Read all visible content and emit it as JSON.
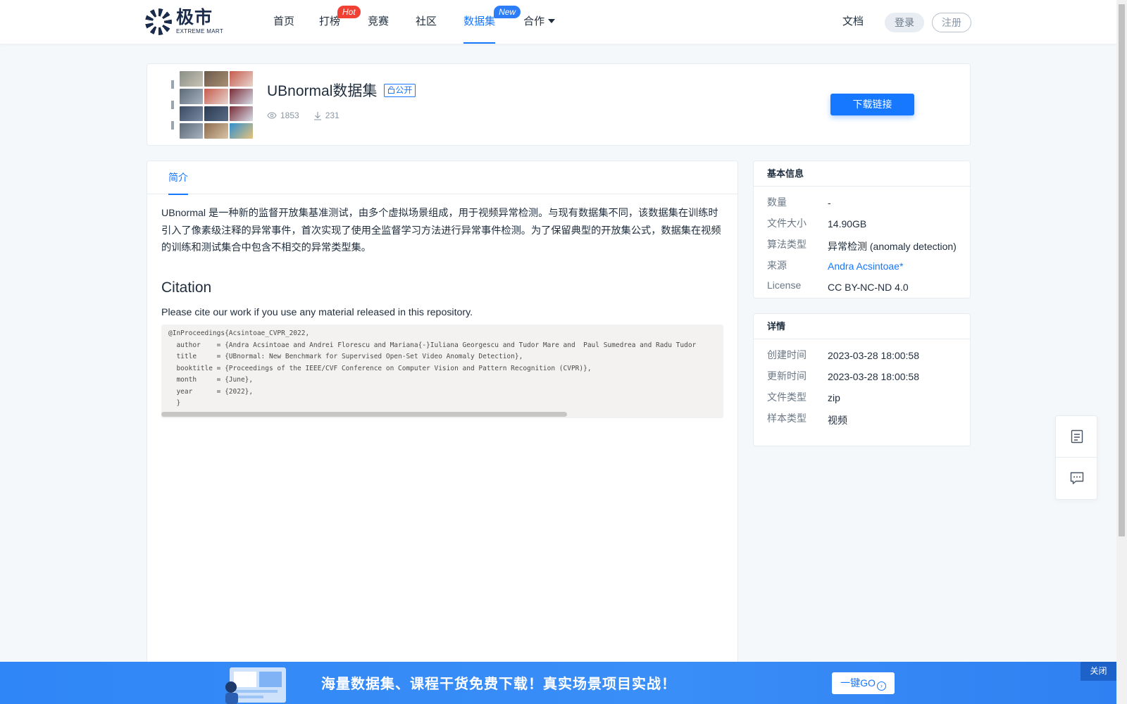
{
  "header": {
    "logo_cn": "极市",
    "logo_en": "EXTREME MART",
    "nav": [
      {
        "label": "首页"
      },
      {
        "label": "打榜",
        "badge": "Hot"
      },
      {
        "label": "竞赛"
      },
      {
        "label": "社区"
      },
      {
        "label": "数据集",
        "badge": "New",
        "active": true
      },
      {
        "label": "合作"
      }
    ],
    "docs_label": "文档",
    "login_label": "登录",
    "register_label": "注册"
  },
  "dataset": {
    "title": "UBnormal数据集",
    "visibility_badge": "公开",
    "views": "1853",
    "downloads": "231",
    "download_button": "下载链接"
  },
  "main": {
    "tab_label": "简介",
    "intro": "UBnormal 是一种新的监督开放集基准测试，由多个虚拟场景组成，用于视频异常检测。与现有数据集不同，该数据集在训练时引入了像素级注释的异常事件，首次实现了使用全监督学习方法进行异常事件检测。为了保留典型的开放集公式，数据集在视频的训练和测试集合中包含不相交的异常类型集。",
    "citation_heading": "Citation",
    "citation_text": "Please cite our work if you use any material released in this repository.",
    "citation_code": "@InProceedings{Acsintoae_CVPR_2022,\n  author    = {Andra Acsintoae and Andrei Florescu and Mariana{-}Iuliana Georgescu and Tudor Mare and  Paul Sumedrea and Radu Tudor\n  title     = {UBnormal: New Benchmark for Supervised Open-Set Video Anomaly Detection},\n  booktitle = {Proceedings of the IEEE/CVF Conference on Computer Vision and Pattern Recognition (CVPR)},\n  month     = {June},\n  year      = {2022},\n  }"
  },
  "basic_info": {
    "title": "基本信息",
    "rows": [
      {
        "label": "数量",
        "value": "-"
      },
      {
        "label": "文件大小",
        "value": "14.90GB"
      },
      {
        "label": "算法类型",
        "value": "异常检测 (anomaly detection)"
      },
      {
        "label": "来源",
        "value": "Andra Acsintoae*"
      },
      {
        "label": "License",
        "value": "CC BY-NC-ND 4.0"
      }
    ]
  },
  "details": {
    "title": "详情",
    "rows": [
      {
        "label": "创建时间",
        "value": "2023-03-28 18:00:58"
      },
      {
        "label": "更新时间",
        "value": "2023-03-28 18:00:58"
      },
      {
        "label": "文件类型",
        "value": "zip"
      },
      {
        "label": "样本类型",
        "value": "视频"
      }
    ]
  },
  "float_tools": [
    "document-icon",
    "comment-icon"
  ],
  "banner": {
    "text": "海量数据集、课程干货免费下载！真实场景项目实战！",
    "go_label": "一键GO",
    "close_label": "关闭"
  },
  "colors": {
    "accent": "#1677ff",
    "hot_badge": "#f04134",
    "banner": "#3a8ef7"
  }
}
